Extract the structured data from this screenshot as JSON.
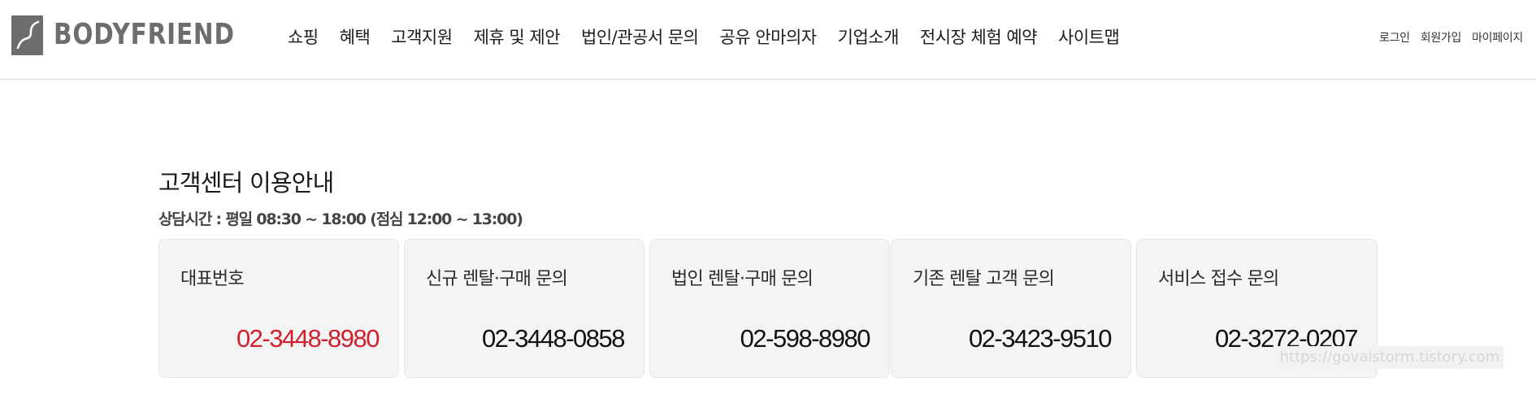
{
  "brand": {
    "name": "BODYFRIEND",
    "logo_icon": "bodyfriend-logo-icon",
    "logo_color": "#6d6d6d"
  },
  "nav": {
    "items": [
      {
        "label": "쇼핑"
      },
      {
        "label": "혜택"
      },
      {
        "label": "고객지원"
      },
      {
        "label": "제휴 및 제안"
      },
      {
        "label": "법인/관공서 문의"
      },
      {
        "label": "공유 안마의자"
      },
      {
        "label": "기업소개"
      },
      {
        "label": "전시장 체험 예약"
      },
      {
        "label": "사이트맵"
      }
    ]
  },
  "util": {
    "login": "로그인",
    "signup": "회원가입",
    "mypage": "마이페이지"
  },
  "section": {
    "title": "고객센터 이용안내",
    "hours": "상담시간 : 평일 08:30 ~ 18:00 (점심 12:00 ~ 13:00)"
  },
  "cards": [
    {
      "label": "대표번호",
      "phone": "02-3448-8980"
    },
    {
      "label": "신규 렌탈·구매 문의",
      "phone": "02-3448-0858"
    },
    {
      "label": "법인 렌탈·구매 문의",
      "phone": "02-598-8980"
    },
    {
      "label": "기존 렌탈 고객 문의",
      "phone": "02-3423-9510"
    },
    {
      "label": "서비스 접수 문의",
      "phone": "02-3272-0207"
    }
  ],
  "colors": {
    "accent": "#d0202e",
    "card_bg": "#f4f4f4"
  },
  "watermark": "https://govalstorm.tistory.com"
}
